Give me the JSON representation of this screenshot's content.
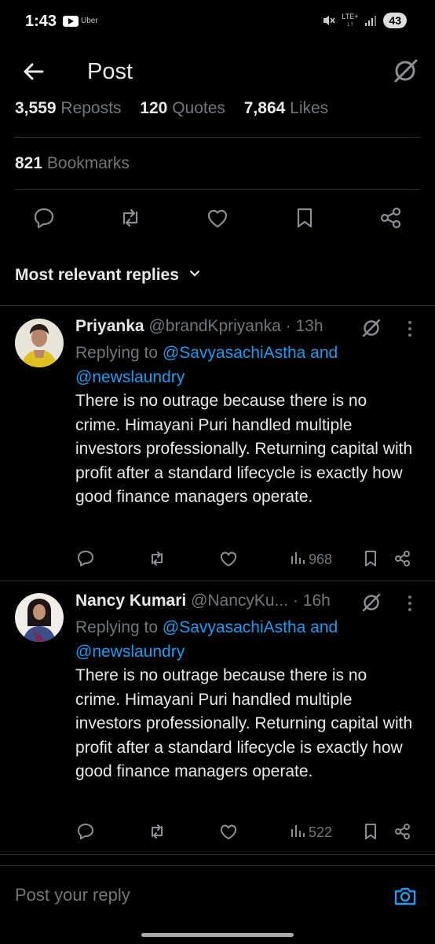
{
  "status_bar": {
    "time": "1:43",
    "app_badge": "Uber",
    "network": "LTE+",
    "battery": "43"
  },
  "header": {
    "title": "Post"
  },
  "stats": {
    "reposts_count": "3,559",
    "reposts_label": "Reposts",
    "quotes_count": "120",
    "quotes_label": "Quotes",
    "likes_count": "7,864",
    "likes_label": "Likes",
    "bookmarks_count": "821",
    "bookmarks_label": "Bookmarks"
  },
  "sort": {
    "label": "Most relevant replies"
  },
  "replies": [
    {
      "name": "Priyanka",
      "handle": "@brandKpriyanka",
      "time": "· 13h",
      "replying_prefix": "Replying to",
      "mention_1": "@SavyasachiAstha",
      "and": "and",
      "mention_2": "@newslaundry",
      "text": "There is no outrage because there is no crime. Himayani Puri handled multiple investors professionally. Returning capital with profit after a standard lifecycle is exactly how good finance managers operate.",
      "views": "968"
    },
    {
      "name": "Nancy Kumari",
      "handle": "@NancyKu...",
      "time": "· 16h",
      "replying_prefix": "Replying to",
      "mention_1": "@SavyasachiAstha",
      "and": "and",
      "mention_2": "@newslaundry",
      "text": "There is no outrage because there is no crime. Himayani Puri handled multiple investors professionally. Returning capital with profit after a standard lifecycle is exactly how good finance managers operate.",
      "views": "522"
    }
  ],
  "compose": {
    "placeholder": "Post your reply"
  },
  "colors": {
    "background": "#000000",
    "text": "#e7e9ea",
    "muted": "#71767b",
    "accent": "#1d9bf0",
    "divider": "#2f3336"
  }
}
